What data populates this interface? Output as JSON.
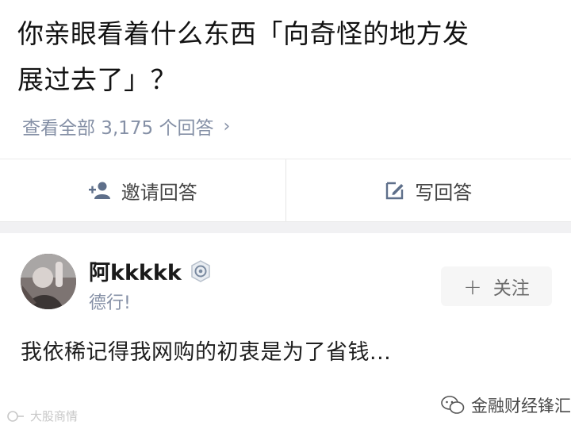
{
  "question": {
    "title_line1": "你亲眼看着什么东西「向奇怪的地方发",
    "title_line2": "展过去了」？",
    "view_all": "查看全部 3,175 个回答",
    "chevron": "›"
  },
  "actions": {
    "invite_label": "邀请回答",
    "write_label": "写回答",
    "invite_icon": "add-user-icon",
    "write_icon": "edit-icon"
  },
  "answer": {
    "author_name": "阿kkkkk",
    "author_bio": "德行!",
    "follow_label": "关注",
    "follow_plus": "+",
    "text": "我依稀记得我网购的初衷是为了省钱..."
  },
  "watermarks": {
    "left": "大股商情",
    "right": "金融财经锋汇"
  },
  "colors": {
    "accent": "#0084ff",
    "muted": "#8590a6",
    "divider": "#f1f1f3"
  }
}
